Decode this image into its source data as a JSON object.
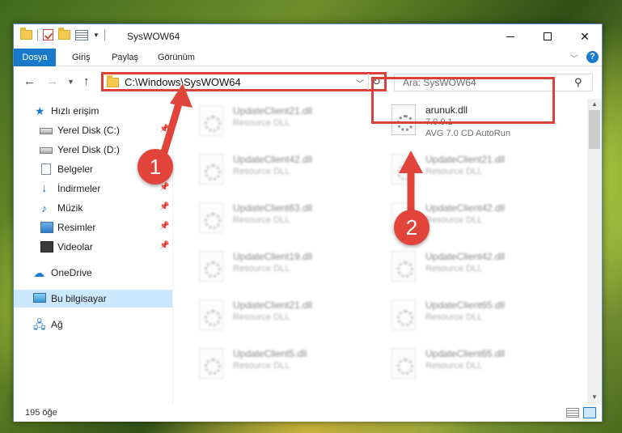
{
  "window": {
    "title": "SysWOW64"
  },
  "ribbon": {
    "tabs": [
      {
        "label": "Dosya"
      },
      {
        "label": "Giriş"
      },
      {
        "label": "Paylaş"
      },
      {
        "label": "Görünüm"
      }
    ]
  },
  "address_bar": {
    "path": "C:\\Windows\\SysWOW64"
  },
  "search": {
    "placeholder": "Ara: SysWOW64"
  },
  "sidebar": {
    "items": [
      {
        "label": "Hızlı erişim"
      },
      {
        "label": "Yerel Disk (C:)"
      },
      {
        "label": "Yerel Disk (D:)"
      },
      {
        "label": "Belgeler"
      },
      {
        "label": "İndirmeler"
      },
      {
        "label": "Müzik"
      },
      {
        "label": "Resimler"
      },
      {
        "label": "Videolar"
      },
      {
        "label": "OneDrive"
      },
      {
        "label": "Bu bilgisayar"
      },
      {
        "label": "Ağ"
      }
    ]
  },
  "files": {
    "left_column": [
      {
        "name": "UpdateClient21.dll",
        "type": "Resource DLL"
      },
      {
        "name": "UpdateClient42.dll",
        "type": "Resource DLL"
      },
      {
        "name": "UpdateClient63.dll",
        "type": "Resource DLL"
      },
      {
        "name": "UpdateClient19.dll",
        "type": "Resource DLL"
      },
      {
        "name": "UpdateClient21.dll",
        "type": "Resource DLL"
      },
      {
        "name": "UpdateClient5.dll",
        "type": "Resource DLL"
      }
    ],
    "right_column": [
      {
        "name": "UpdateClient21.dll",
        "type": "Resource DLL"
      },
      {
        "name": "UpdateClient42.dll",
        "type": "Resource DLL"
      },
      {
        "name": "UpdateClient42.dll",
        "type": "Resource DLL"
      },
      {
        "name": "UpdateClient65.dll",
        "type": "Resource DLL"
      },
      {
        "name": "UpdateClient65.dll",
        "type": "Resource DLL"
      }
    ],
    "highlighted": {
      "name": "arunuk.dll",
      "version": "7.0.0.1",
      "description": "AVG 7.0 CD AutoRun"
    }
  },
  "status_bar": {
    "item_count": "195 öğe"
  },
  "annotations": {
    "step1": "1",
    "step2": "2",
    "color": "#e0443a"
  },
  "colors": {
    "accent": "#1979ca",
    "highlight_border": "#d9413a",
    "selected_bg": "#cce8ff"
  }
}
